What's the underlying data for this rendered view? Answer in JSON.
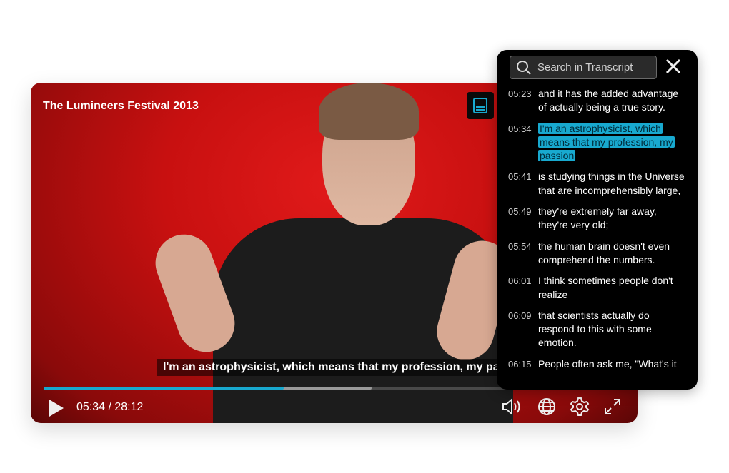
{
  "player": {
    "title": "The Lumineers Festival 2013",
    "caption": "I'm an astrophysicist, which means that my profession, my passion",
    "time": "05:34 / 28:12",
    "progress_fraction": 0.41,
    "buffered_fraction": 0.56,
    "accent": "#18a9cf"
  },
  "transcript": {
    "search_placeholder": "Search in Transcript",
    "entries": [
      {
        "time": "05:23",
        "text": "and it has the added advantage of actually being a true story."
      },
      {
        "time": "05:34",
        "text": "I'm an astrophysicist, which means that my profession, my passion",
        "active": true
      },
      {
        "time": "05:41",
        "text": "is studying things in the Universe that are incomprehensibly large,"
      },
      {
        "time": "05:49",
        "text": "they're extremely far away, they're very old;"
      },
      {
        "time": "05:54",
        "text": "the human brain doesn't even comprehend the numbers."
      },
      {
        "time": "06:01",
        "text": "I think sometimes people don't realize"
      },
      {
        "time": "06:09",
        "text": "that scientists actually do respond to this with some emotion."
      },
      {
        "time": "06:15",
        "text": "People often ask me, \"What's it"
      }
    ]
  }
}
